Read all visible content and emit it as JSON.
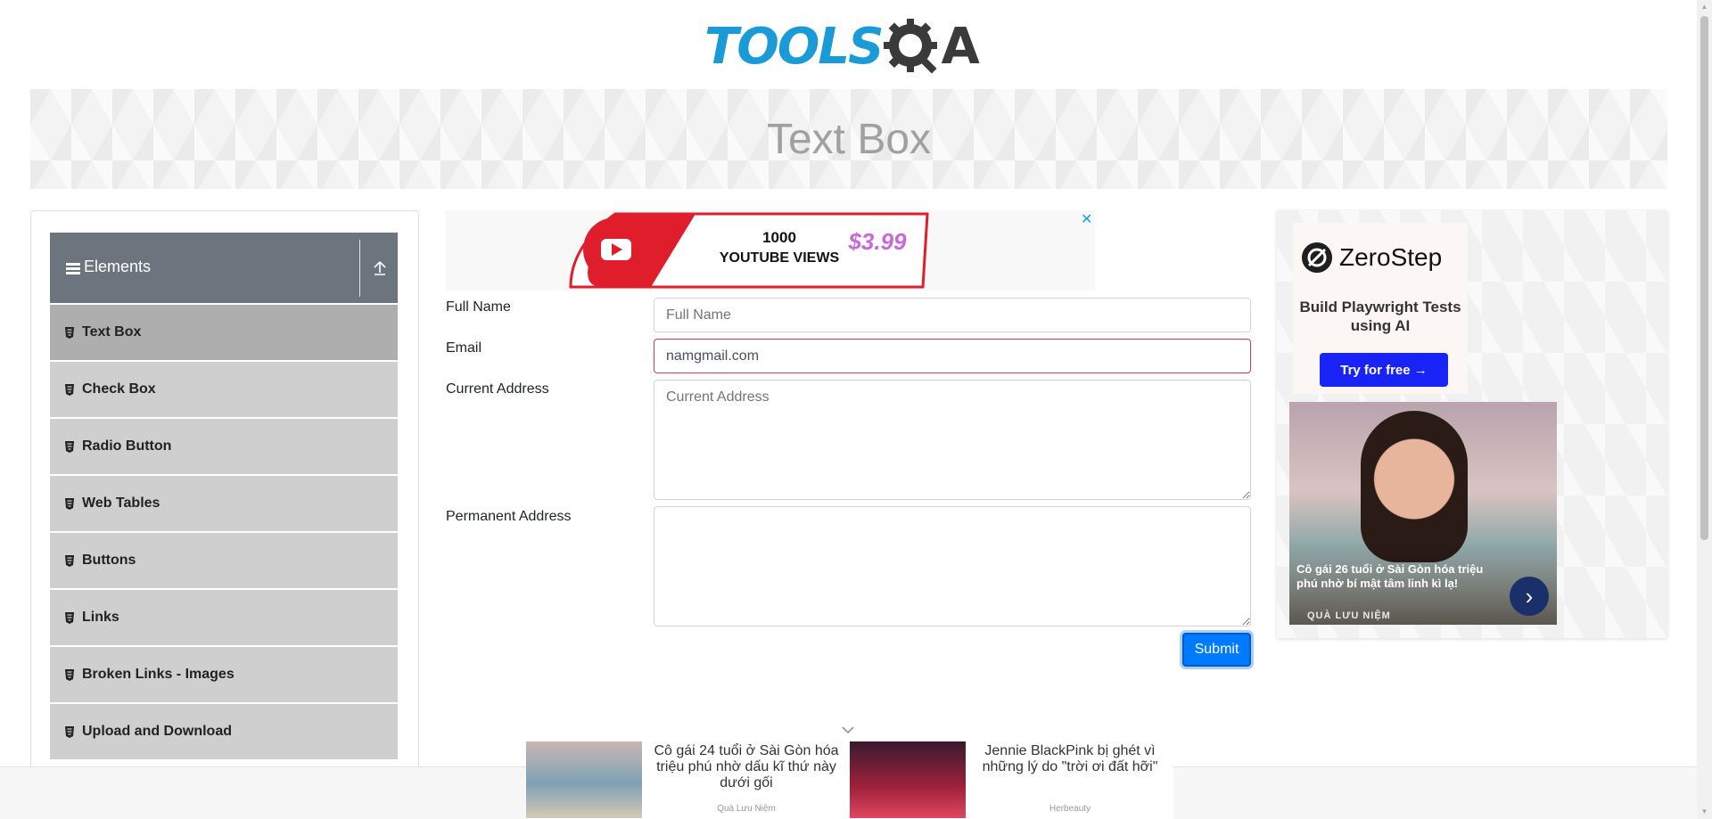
{
  "logo": {
    "tools": "TOOLS",
    "a": "A"
  },
  "banner": {
    "title": "Text Box"
  },
  "sidebar": {
    "group": {
      "label": "Elements"
    },
    "items": [
      {
        "label": "Text Box",
        "active": true
      },
      {
        "label": "Check Box"
      },
      {
        "label": "Radio Button"
      },
      {
        "label": "Web Tables"
      },
      {
        "label": "Buttons"
      },
      {
        "label": "Links"
      },
      {
        "label": "Broken Links - Images"
      },
      {
        "label": "Upload and Download"
      }
    ]
  },
  "ad_top": {
    "views": "1000",
    "label": "YOUTUBE VIEWS",
    "price": "$3.99",
    "close": "✕"
  },
  "form": {
    "full_name": {
      "label": "Full Name",
      "placeholder": "Full Name",
      "value": ""
    },
    "email": {
      "label": "Email",
      "value": "namgmail.com",
      "state": "error"
    },
    "current_address": {
      "label": "Current Address",
      "placeholder": "Current Address"
    },
    "permanent_address": {
      "label": "Permanent Address",
      "placeholder": ""
    },
    "submit_label": "Submit"
  },
  "ad_right": {
    "brand": "ZeroStep",
    "tagline": "Build Playwright Tests using AI",
    "cta": "Try for free →",
    "photo_text": "Cô gái 26 tuổi ở Sài Gòn hóa triệu phú nhờ bí mật tâm linh kì lạ!",
    "photo_source": "QUÀ LƯU NIỆM"
  },
  "sticky_ad": {
    "items": [
      {
        "title": "Cô gái 24 tuổi ở Sài Gòn hóa triệu phú nhờ dấu kĩ thứ này dưới gối",
        "source": "Quà Lưu Niệm"
      },
      {
        "title": "Jennie BlackPink bị ghét vì những lý do \"trời ơi đất hỡi\"",
        "source": "Herbeauty"
      }
    ]
  },
  "colors": {
    "brand_blue": "#1a9bd7",
    "sidebar_header": "#6c757d",
    "menu_item": "#cfcfcf",
    "menu_active": "#aeaeae",
    "primary": "#007bff",
    "error": "#dc3545"
  },
  "icons": {
    "group": "hamburger-icon",
    "toggle": "collapse-up-icon",
    "menu_item": "html5-badge-icon"
  }
}
